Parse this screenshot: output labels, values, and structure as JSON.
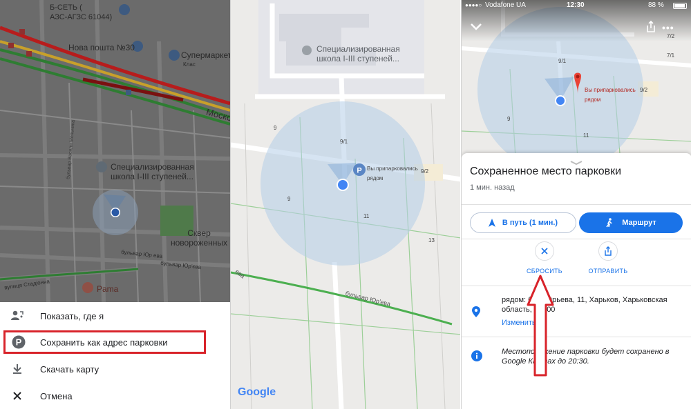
{
  "panel1": {
    "map_labels": {
      "gas_station": "Б-СЕТЬ (\nАЗС-АГЗС 61044)",
      "nova_poshta": "Нова пошта №30",
      "supermarket": "Супермаркет",
      "supermarket_sub": "Клас",
      "street_moscow": "Моско",
      "street_vasily": "бульвар Василя Мельника",
      "school": "Специализированная\nшкола I-III ступеней...",
      "square": "Сквер\nновороженных",
      "blvd_yuriev": "бульвар Юр ева",
      "blvd_yuriev2": "бульвар Юр'єва",
      "stadium": "вулиця Стадіонна",
      "restaurant": "Pama"
    },
    "menu": [
      {
        "label": "Показать, где я",
        "icon": "person-location-icon"
      },
      {
        "label": "Сохранить как адрес парковки",
        "icon": "parking-icon"
      },
      {
        "label": "Скачать карту",
        "icon": "download-icon"
      },
      {
        "label": "Отмена",
        "icon": "close-icon"
      }
    ]
  },
  "panel2": {
    "school": "Специализированная\nшкола I-III ступеней...",
    "parked_label": "Вы припарковались\nрядом",
    "num_9": "9",
    "num_9_1": "9/1",
    "num_9_2": "9/2",
    "num_11": "11",
    "num_13": "13",
    "num_9b": "9",
    "blvd": "бульвар Юр'ева",
    "street_rot": "ева",
    "google": "Google"
  },
  "panel3": {
    "status": {
      "carrier": "Vodafone UA",
      "time": "12:30",
      "battery": "88 %"
    },
    "map_labels": {
      "n7_1": "7/1",
      "n7_2": "7/2",
      "n9_1": "9/1",
      "n9_2": "9/2",
      "n9": "9",
      "n11": "11",
      "parked": "Вы припарковались\nрядом"
    },
    "card": {
      "title": "Сохраненное место парковки",
      "subtitle": "1 мин. назад",
      "nav_button": "В путь (1 мин.)",
      "route_button": "Маршрут",
      "reset_label": "СБРОСИТЬ",
      "share_label": "ОТПРАВИТЬ",
      "address": "рядом: бул. Юрьева, 11, Харьков, Харьковская область, 61000",
      "edit_link": "Изменить",
      "info": "Местоположение парковки будет сохранено в Google Картах до 20:30."
    }
  },
  "colors": {
    "accent": "#1a73e8",
    "highlight": "#d8232a",
    "marker": "#ea4335"
  }
}
